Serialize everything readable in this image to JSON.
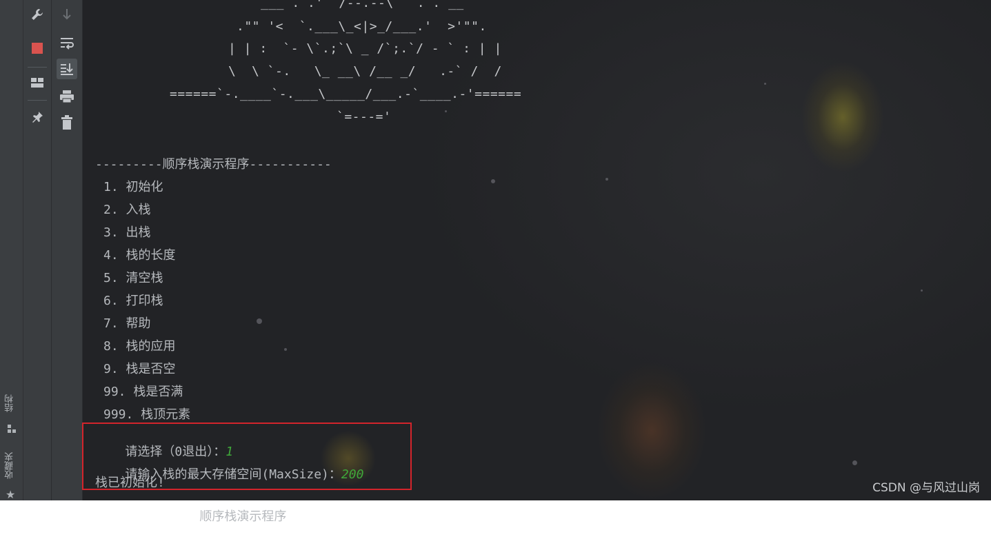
{
  "console": {
    "banner_lines": [
      "___ . .'  /--.--\\   . . __",
      ".\"\" '<  `.___\\_<|>_/___.'  >'\"\".",
      "| | :  `- \\`.;`\\ _ /`;.`/ - ` : | |",
      "\\  \\ `-.   \\_ __\\ /__ _/   .-` /  /",
      "======`-.____`-.___\\_____/___.-`____.-'======",
      "`=---='"
    ],
    "menu_title": "---------顺序栈演示程序-----------",
    "menu_items": [
      "1. 初始化",
      "2. 入栈",
      "3. 出栈",
      "4. 栈的长度",
      "5. 清空栈",
      "6. 打印栈",
      "7. 帮助",
      "8. 栈的应用",
      "9. 栈是否空",
      "99. 栈是否满",
      "999. 栈顶元素"
    ],
    "prompt_choose": "请选择（0退出）：",
    "input_choose": "1",
    "prompt_maxsize": "请输入栈的最大存储空间(MaxSize)：",
    "input_maxsize": "200",
    "result": "栈已初始化!",
    "next_title_partial": "顺序栈演示程序"
  },
  "side_labels": {
    "structure": "结构",
    "favorites": "收藏夹"
  },
  "watermark": "CSDN @与风过山岗",
  "icons": {
    "strip1": [
      "wrench-icon",
      "stop-icon",
      "layout-icon",
      "pin-icon"
    ],
    "strip2": [
      "scroll-down-arrow-icon",
      "soft-wrap-icon",
      "scroll-to-end-icon",
      "print-icon",
      "trash-icon"
    ]
  },
  "colors": {
    "stop": "#d9534f",
    "input_green": "#3fa83a",
    "highlight_border": "#d4242b"
  }
}
